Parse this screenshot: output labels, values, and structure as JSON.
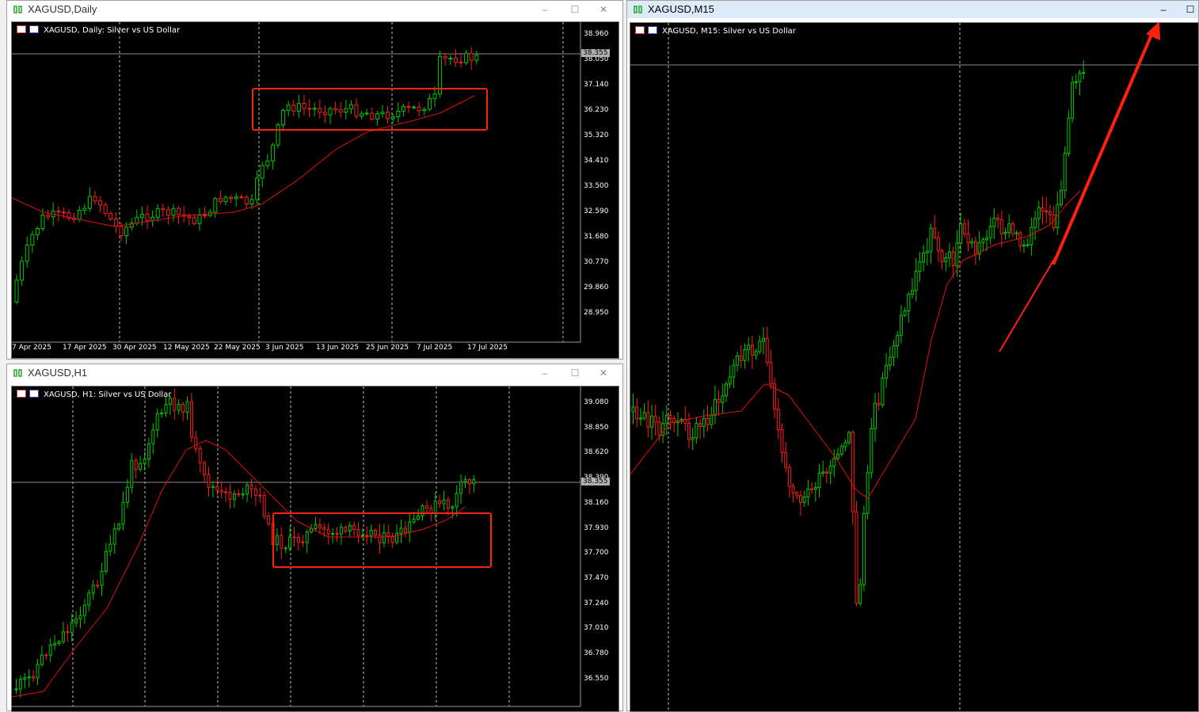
{
  "colors": {
    "bull": "#00c800",
    "bear": "#ff1a1a",
    "ma": "#e01010",
    "box": "#ff2010",
    "grid": "#ffffff",
    "price_line": "#8a8a8a"
  },
  "windows": [
    {
      "key": "daily",
      "title": "XAGUSD,Daily",
      "chart_label": "XAGUSD, Daily:  Silver vs US Dollar",
      "y_ticks": [
        "38.960",
        "38.050",
        "37.140",
        "36.230",
        "35.320",
        "34.410",
        "33.500",
        "32.590",
        "31.680",
        "30.770",
        "29.860",
        "28.950"
      ],
      "price": "38.355",
      "x_labels": [
        "7 Apr 2025",
        "17 Apr 2025",
        "30 Apr 2025",
        "12 May 2025",
        "22 May 2025",
        "3 Jun 2025",
        "13 Jun 2025",
        "25 Jun 2025",
        "7 Jul 2025",
        "17 Jul 2025"
      ]
    },
    {
      "key": "h1",
      "title": "XAGUSD,H1",
      "chart_label": "XAGUSD, H1:  Silver vs US Dollar",
      "y_ticks": [
        "39.080",
        "38.850",
        "38.620",
        "38.390",
        "38.160",
        "37.930",
        "37.700",
        "37.470",
        "37.240",
        "37.010",
        "36.780",
        "36.550"
      ],
      "price": "38.355",
      "x_labels": []
    },
    {
      "key": "m15",
      "title": "XAGUSD,M15",
      "chart_label": "XAGUSD, M15:  Silver vs US Dollar",
      "y_ticks": [],
      "price": "",
      "x_labels": []
    }
  ]
}
